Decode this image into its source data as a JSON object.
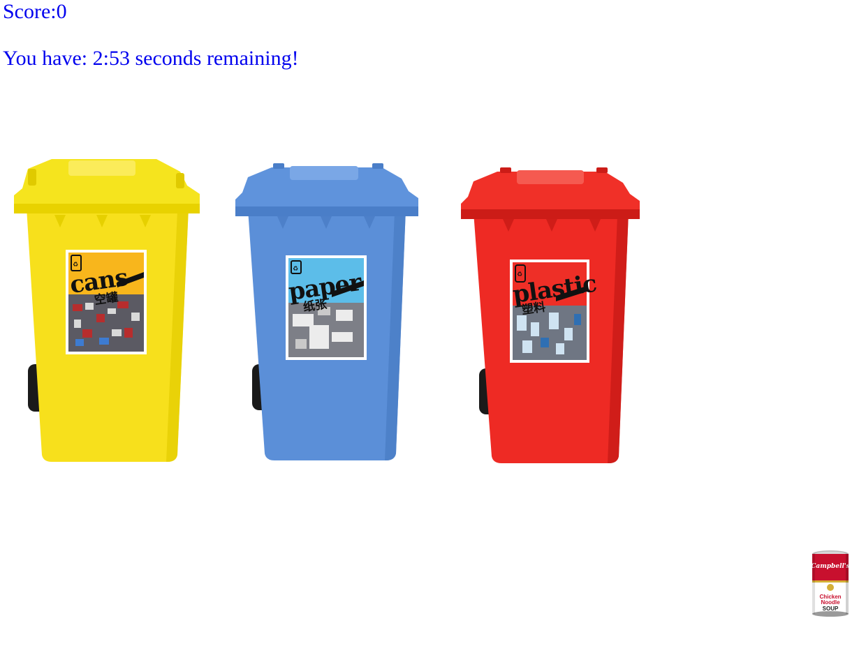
{
  "hud": {
    "score_text": "Score:0",
    "timer_text": "You have: 2:53 seconds remaining!"
  },
  "bins": [
    {
      "id": "cans",
      "label": "cans",
      "label_cjk": "空罐",
      "color": "#f7e01c",
      "color_dark": "#d9c400",
      "icon": "recycle-icon"
    },
    {
      "id": "paper",
      "label": "paper",
      "label_cjk": "纸张",
      "color": "#5b8fd8",
      "color_dark": "#3f73bd",
      "icon": "recycle-icon"
    },
    {
      "id": "plastic",
      "label": "plastic",
      "label_cjk": "塑料",
      "color": "#ee2a24",
      "color_dark": "#c81a16",
      "icon": "recycle-icon"
    }
  ],
  "draggable_item": {
    "brand": "Campbell's",
    "line1": "Chicken",
    "line2": "Noodle",
    "line3": "SOUP",
    "icon": "soup-can-icon"
  },
  "colors": {
    "hud_text": "#0000ee"
  }
}
